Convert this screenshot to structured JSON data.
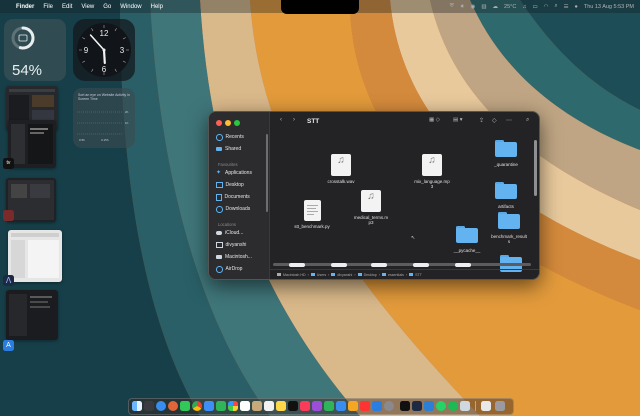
{
  "menubar": {
    "app_name": "Finder",
    "items": [
      "File",
      "Edit",
      "View",
      "Go",
      "Window",
      "Help"
    ],
    "weather": "25°C",
    "datetime": "Thu 13 Aug  5:53 PM"
  },
  "widgets": {
    "battery_percent": "54%",
    "battery_level": 0.54,
    "clock_numbers": [
      "12",
      "3",
      "6",
      "9"
    ],
    "clock_time": "5:53",
    "chart_title": "Sort an eye on Website Activity in Screen Time",
    "chart_labels": [
      "2h",
      "1h",
      "0.5h",
      "3.15h"
    ]
  },
  "finder": {
    "title": "STT",
    "sidebar": {
      "favorites": [
        "Recents",
        "Shared"
      ],
      "favorites_header": "Favourites",
      "favorites2": [
        "Applications",
        "Desktop",
        "Documents",
        "Downloads"
      ],
      "locations_header": "Locations",
      "locations": [
        "iCloud...",
        "divyanshi",
        "Macintosh...",
        "AirDrop"
      ]
    },
    "files": {
      "crosstalk": "crosstalk.wav",
      "mix_language": "mix_language.mp3",
      "mix_language_l1": "mix_language.mp",
      "mix_language_l2": "3",
      "medical_l1": "medical_terms.m",
      "medical_l2": "p3",
      "stt_benchmark": "stt_benchmark.py",
      "quarantine": "_quarantine",
      "artifacts": "artifacts",
      "benchmark_l1": "benchmark_result",
      "benchmark_l2": "s",
      "pycache": "__pycache__"
    },
    "pathbar": [
      "Macintosh HD",
      "Users",
      "divyanshi",
      "Desktop",
      "essentials",
      "STT"
    ]
  },
  "colors": {
    "folder_blue": "#62b3ef",
    "close": "#ff5f57",
    "minimize": "#febc2e",
    "zoom": "#28c840"
  }
}
